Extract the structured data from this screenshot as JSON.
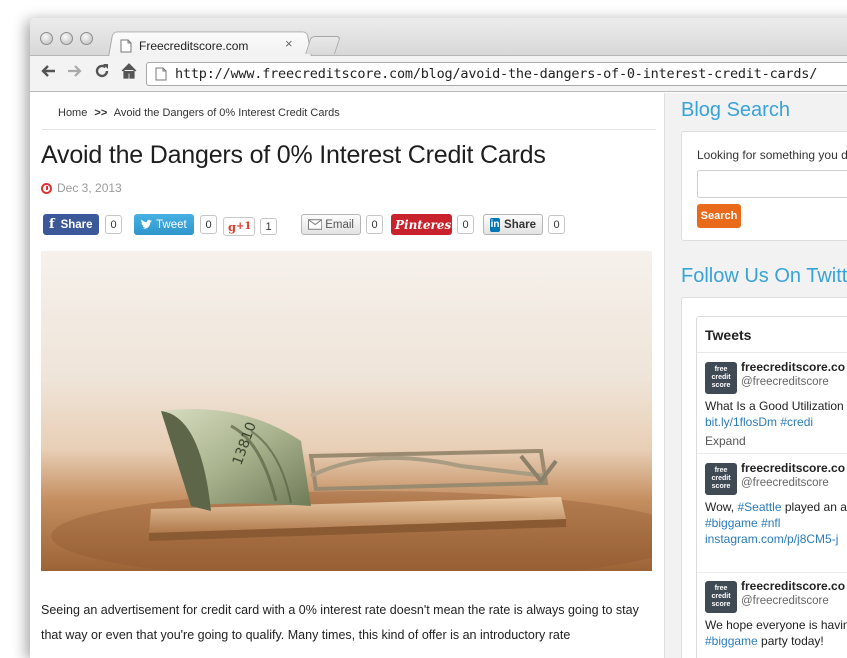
{
  "browser": {
    "tab_title": "Freecreditscore.com",
    "tab_close": "×",
    "url": "http://www.freecreditscore.com/blog/avoid-the-dangers-of-0-interest-credit-cards/"
  },
  "breadcrumb": {
    "home": "Home",
    "separator": ">>",
    "current": "Avoid the Dangers of 0% Interest Credit Cards"
  },
  "article": {
    "title": "Avoid the Dangers of 0% Interest Credit Cards",
    "date": "Dec 3, 2013",
    "body": "Seeing an advertisement for credit card with a 0% interest rate doesn't mean the rate is always going to stay that way or even that you're going to qualify. Many times, this kind of offer is an introductory rate"
  },
  "share": [
    {
      "network": "facebook",
      "label": "Share",
      "count": "0",
      "color": "#3b5998"
    },
    {
      "network": "twitter",
      "label": "Tweet",
      "count": "0",
      "color": "#33a3d8"
    },
    {
      "network": "google-plus",
      "label": "+1",
      "count": "1",
      "color": "#dd3b2b"
    },
    {
      "network": "email",
      "label": "Email",
      "count": "0",
      "color": "#777777"
    },
    {
      "network": "pinterest",
      "label": "Pinterest",
      "count": "0",
      "color": "#c8232c"
    },
    {
      "network": "linkedin",
      "label": "Share",
      "count": "0",
      "color": "#0077b5"
    }
  ],
  "sidebar": {
    "search_title": "Blog Search",
    "search_label": "Looking for something you d",
    "search_button": "Search",
    "follow_title": "Follow Us On Twitt",
    "tweets_header": "Tweets",
    "tweets": [
      {
        "name": "freecreditscore.co",
        "handle": "@freecreditscore",
        "text": "What Is a Good Utilization Card?",
        "link": "bit.ly/1flosDm",
        "tag": "#credi",
        "expand": "Expand"
      },
      {
        "name": "freecreditscore.co",
        "handle": "@freecreditscore",
        "text_pre": "Wow, ",
        "tag1": "#Seattle",
        "text_mid": " played an a tonight! ",
        "tag2": "#biggame",
        "tag3": "#nfl",
        "link": "instagram.com/p/j8CM5-j"
      },
      {
        "name": "freecreditscore.co",
        "handle": "@freecreditscore",
        "text_pre": "We hope everyone is havin",
        "tag1": "#biggame",
        "text_post": " party today!"
      }
    ],
    "avatar_text": "free credit score"
  },
  "colors": {
    "accent_blue": "#37a3d9",
    "search_orange": "#ea6a1b",
    "date_icon_red": "#dd3333"
  }
}
